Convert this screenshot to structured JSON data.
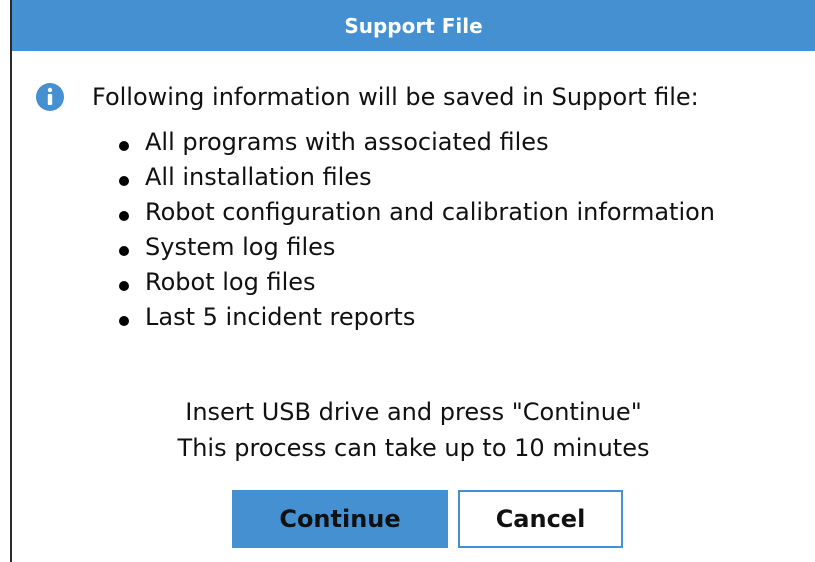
{
  "dialog": {
    "title": "Support File",
    "info_text": "Following information will be saved in Support file:",
    "items": [
      "All programs with associated files",
      "All installation files",
      "Robot configuration and calibration information",
      "System log files",
      "Robot log files",
      "Last 5 incident reports"
    ],
    "instruction_1": "Insert USB drive and press \"Continue\"",
    "instruction_2": "This process can take up to 10 minutes",
    "continue_label": "Continue",
    "cancel_label": "Cancel"
  },
  "colors": {
    "accent": "#4590d1",
    "text": "#111111",
    "background": "#ffffff"
  },
  "icons": {
    "info": "info-icon"
  }
}
